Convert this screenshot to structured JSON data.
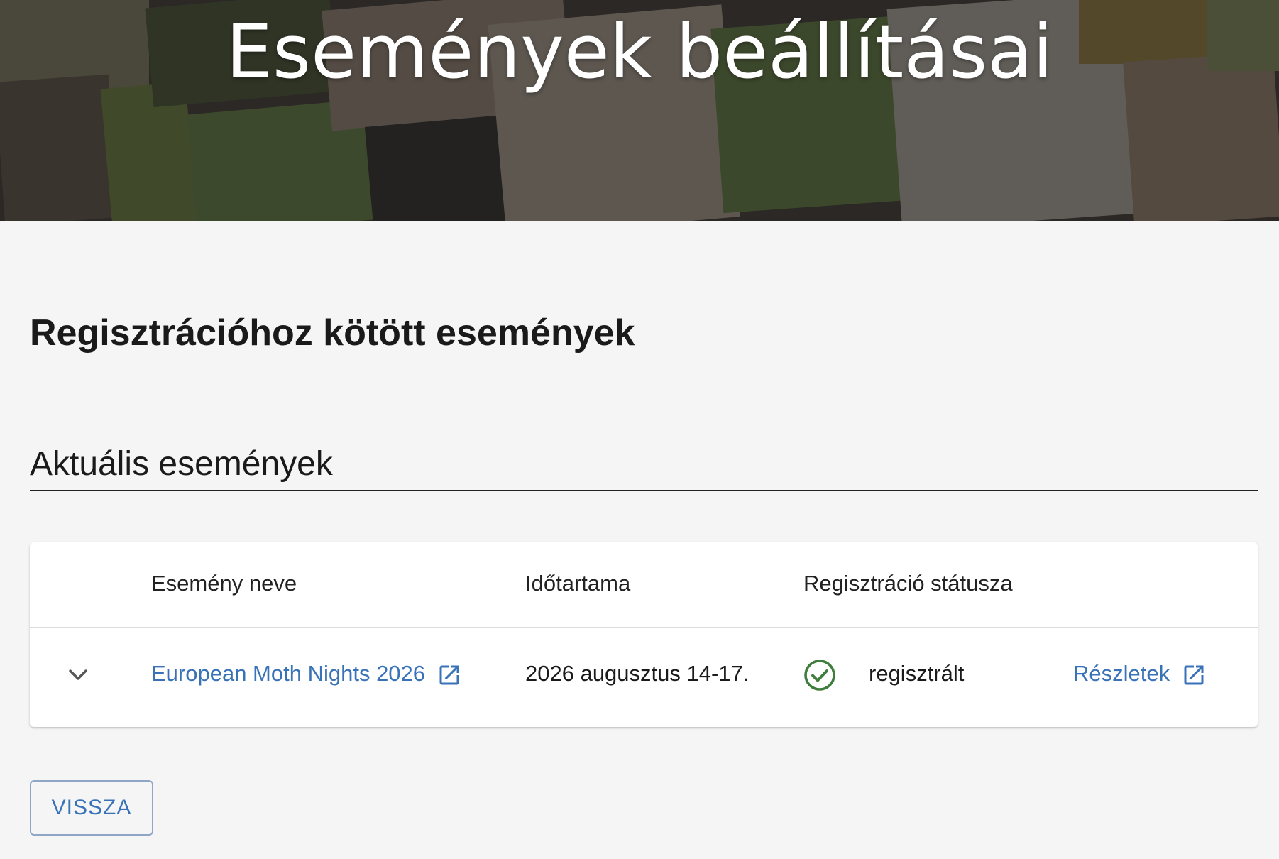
{
  "header": {
    "title": "Események beállításai"
  },
  "page": {
    "heading": "Regisztrációhoz kötött események",
    "section_title": "Aktuális események"
  },
  "table": {
    "columns": [
      "Esemény neve",
      "Időtartama",
      "Regisztráció státusza"
    ],
    "rows": [
      {
        "name": "European Moth Nights 2026",
        "duration": "2026 augusztus 14-17.",
        "status": "regisztrált",
        "details_label": "Részletek"
      }
    ]
  },
  "actions": {
    "back_label": "VISSZA"
  },
  "colors": {
    "link": "#3a72b8",
    "status_ok": "#3f7d3c",
    "background": "#f5f5f5"
  },
  "icons": {
    "expand": "chevron-down-icon",
    "external": "open-in-new-icon",
    "status": "check-circle-icon"
  }
}
